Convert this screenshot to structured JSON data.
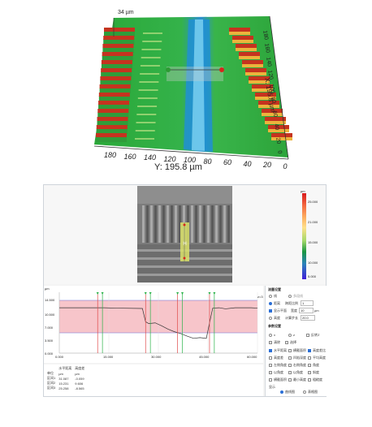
{
  "view3d": {
    "z_label": "34 µm",
    "x_label": "X: 195.8 µm",
    "y_label": "Y: 195.8 µm",
    "y_ticks": [
      "180",
      "160",
      "140",
      "120",
      "100",
      "80",
      "60",
      "40",
      "20",
      "0"
    ],
    "x_ticks": [
      "0",
      "20",
      "40",
      "60",
      "80",
      "100",
      "120",
      "140",
      "160",
      "180"
    ]
  },
  "colorbar": {
    "unit": "µm",
    "ticks": [
      "25.000",
      "21.000",
      "15.000",
      "10.000",
      "5.000"
    ]
  },
  "profile": {
    "y_unit": "µm",
    "y_ticks": [
      "14.500",
      "10.500",
      "7.000",
      "3.500",
      "0.000"
    ],
    "x_ticks": [
      "0.000",
      "15.000",
      "30.000",
      "45.000",
      "60.000"
    ],
    "side_label": "z=3"
  },
  "results": {
    "headers": [
      "",
      "水平距离",
      "高度差"
    ],
    "unit_row": [
      "单位",
      "µm",
      "µm"
    ],
    "rows": [
      [
        "区间1",
        "31.087",
        "-0.059"
      ],
      [
        "区间2",
        "15.231",
        "9.606"
      ],
      [
        "区间3",
        "25.258",
        "-8.565"
      ]
    ]
  },
  "settings": {
    "section1_title": "测量设置",
    "opt_line": "线",
    "opt_multi": "多段线",
    "opt_distance": "距离",
    "span_label": "跨距比例",
    "span_value": "1",
    "show_plane": "显示平面",
    "width_label": "宽度",
    "width_value": "10",
    "width_unit": "µm",
    "opt_height": "高度",
    "calc_label": "计算步长",
    "calc_value": "20.0",
    "section2_title": "参数设置",
    "param_x": "x",
    "param_z": "z",
    "param_flip": "反转Z",
    "opt_clear": "清除",
    "opt_select": "选择",
    "checks": [
      [
        "水平距离",
        "横截面积",
        "高度差比"
      ],
      [
        "高度差",
        "凹陷深度",
        "平均高度"
      ],
      [
        "左侧角度",
        "右侧角度",
        "角度"
      ],
      [
        "以角度",
        "以角度",
        "斜度"
      ],
      [
        "横截面积",
        "最小高度",
        "粗糙度"
      ]
    ],
    "checked": [
      [
        true,
        false,
        true
      ],
      [
        false,
        false,
        false
      ],
      [
        false,
        false,
        false
      ],
      [
        false,
        false,
        false
      ],
      [
        false,
        false,
        false
      ]
    ],
    "mode_label": "显示",
    "mode_a": "曲线图",
    "mode_b": "表格图"
  }
}
